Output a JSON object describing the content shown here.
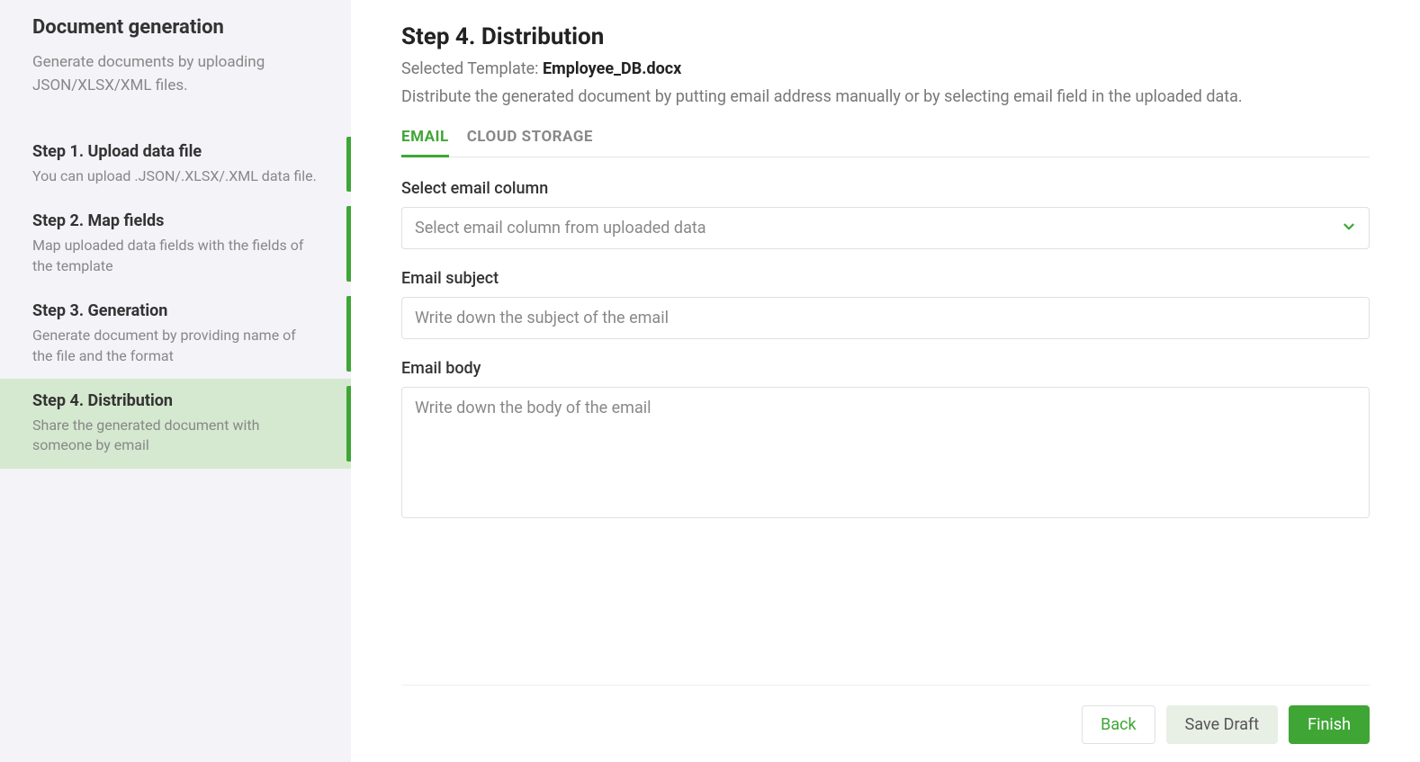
{
  "sidebar": {
    "title": "Document generation",
    "subtitle": "Generate documents by uploading JSON/XLSX/XML files.",
    "steps": [
      {
        "title": "Step 1. Upload data file",
        "desc": "You can upload .JSON/.XLSX/.XML data file."
      },
      {
        "title": "Step 2. Map fields",
        "desc": "Map uploaded data fields with the fields of the template"
      },
      {
        "title": "Step 3. Generation",
        "desc": "Generate document by providing name of the file and the format"
      },
      {
        "title": "Step 4. Distribution",
        "desc": "Share the generated document with someone by email"
      }
    ]
  },
  "main": {
    "title": "Step 4. Distribution",
    "template_label": "Selected Template: ",
    "template_name": "Employee_DB.docx",
    "desc": "Distribute the generated document by putting email address manually or by selecting email field in the uploaded data.",
    "tabs": {
      "email": "EMAIL",
      "cloud": "CLOUD STORAGE"
    },
    "form": {
      "select_label": "Select email column",
      "select_placeholder": "Select email column from uploaded data",
      "subject_label": "Email subject",
      "subject_placeholder": "Write down the subject of the email",
      "body_label": "Email body",
      "body_placeholder": "Write down the body of the email"
    },
    "buttons": {
      "back": "Back",
      "draft": "Save Draft",
      "finish": "Finish"
    }
  }
}
